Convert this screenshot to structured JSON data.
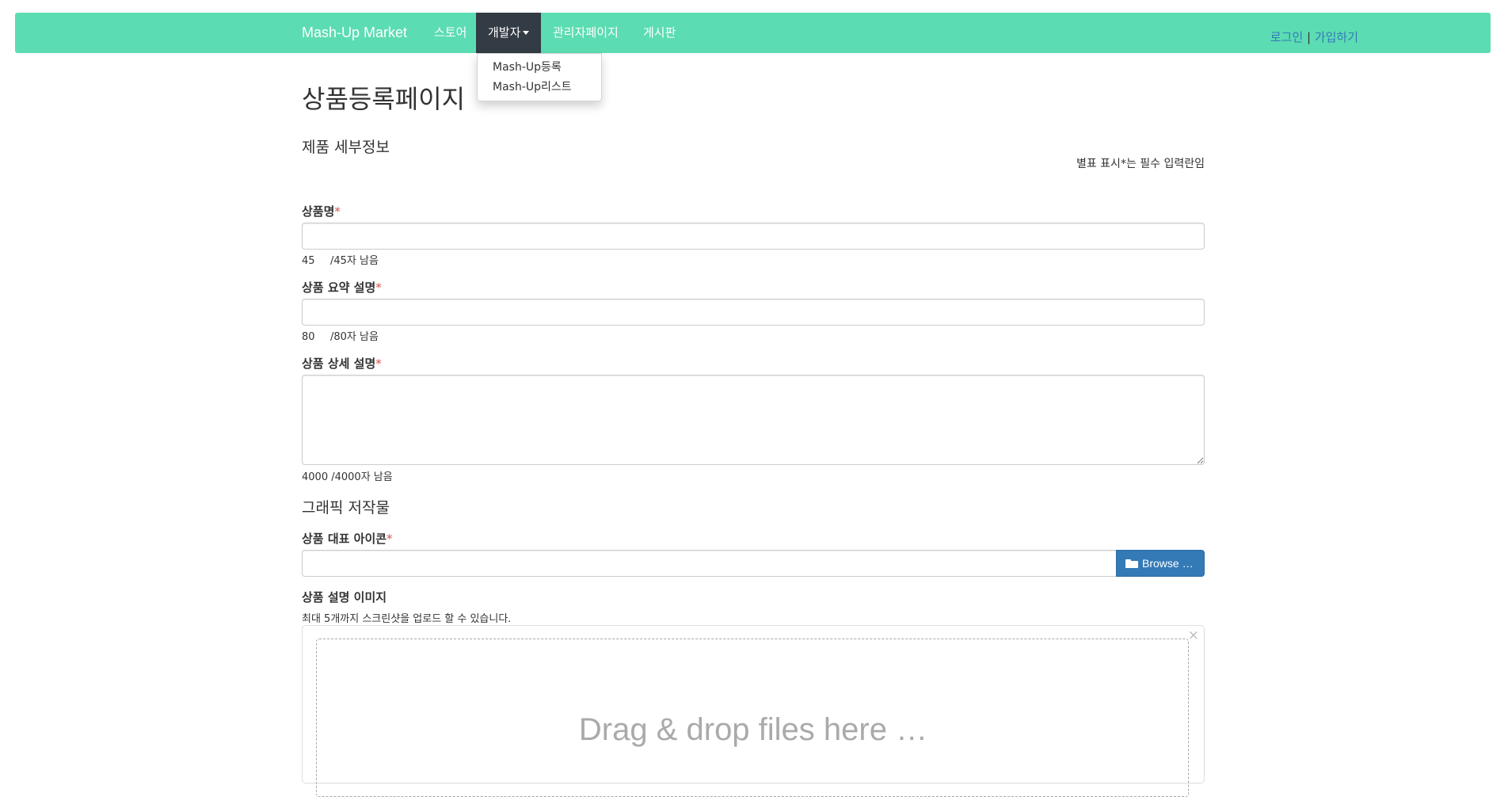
{
  "navbar": {
    "brand": "Mash-Up Market",
    "items": [
      {
        "label": "스토어"
      },
      {
        "label": "개발자"
      },
      {
        "label": "관리자페이지"
      },
      {
        "label": "게시판"
      }
    ],
    "auth": {
      "login": "로그인",
      "separator": "|",
      "signup": "가입하기"
    },
    "dropdown": {
      "items": [
        {
          "label": "Mash-Up등록"
        },
        {
          "label": "Mash-Up리스트"
        }
      ]
    },
    "colors": {
      "background": "#5cdcb2",
      "active_background": "#333b44",
      "link": "#337ab7"
    }
  },
  "page": {
    "title": "상품등록페이지"
  },
  "details": {
    "heading": "제품 세부정보",
    "required_note": "별표 표시*는 필수 입력란임",
    "fields": [
      {
        "label": "상품명",
        "required": "*",
        "value": "",
        "count": "45",
        "limit": "/45자 남음"
      },
      {
        "label": "상품 요약 설명",
        "required": "*",
        "value": "",
        "count": "80",
        "limit": "/80자 남음"
      },
      {
        "label": "상품 상세 설명",
        "required": "*",
        "value": "",
        "count": "4000",
        "limit": "/4000자 남음"
      }
    ]
  },
  "graphics": {
    "heading": "그래픽 저작물",
    "icon_field": {
      "label": "상품 대표 아이콘",
      "required": "*",
      "browse_label": "Browse …",
      "browse_icon": "folder-open-icon"
    },
    "images_field": {
      "label": "상품 설명 이미지",
      "help": "최대 5개까지 스크린샷을 업로드 할 수 있습니다.",
      "drop_text": "Drag & drop files here …",
      "close_symbol": "×"
    }
  }
}
